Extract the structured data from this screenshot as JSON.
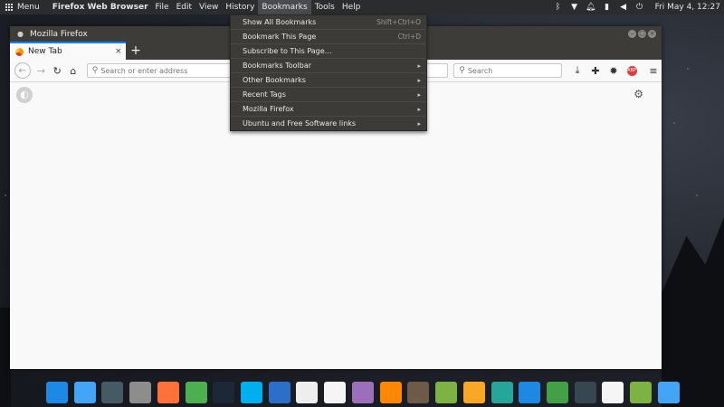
{
  "top_panel": {
    "menu_label": "Menu",
    "app_name": "Firefox Web Browser",
    "menus": [
      "File",
      "Edit",
      "View",
      "History",
      "Bookmarks",
      "Tools",
      "Help"
    ],
    "active_menu": "Bookmarks",
    "clock": "Fri May 4, 12:27"
  },
  "window": {
    "title": "Mozilla Firefox",
    "tab": {
      "title": "New Tab",
      "close": "×"
    },
    "new_tab": "+",
    "url_placeholder": "Search or enter address",
    "search_placeholder": "Search"
  },
  "bookmarks_menu": {
    "items": [
      {
        "label": "Show All Bookmarks",
        "shortcut": "Shift+Ctrl+O",
        "submenu": ""
      },
      {
        "label": "Bookmark This Page",
        "shortcut": "Ctrl+D",
        "submenu": ""
      },
      {
        "label": "Subscribe to This Page…",
        "shortcut": "",
        "submenu": ""
      },
      {
        "label": "Bookmarks Toolbar",
        "shortcut": "",
        "submenu": "▸"
      },
      {
        "label": "Other Bookmarks",
        "shortcut": "",
        "submenu": "▸"
      },
      {
        "label": "Recent Tags",
        "shortcut": "",
        "submenu": "▸"
      },
      {
        "label": "Mozilla Firefox",
        "shortcut": "",
        "submenu": "▸"
      },
      {
        "label": "Ubuntu and Free Software links",
        "shortcut": "",
        "submenu": "▸"
      }
    ]
  },
  "dock": [
    {
      "name": "anchor-icon",
      "color": "#1e88e5"
    },
    {
      "name": "desktop-icon",
      "color": "#42a5f5"
    },
    {
      "name": "screenshot-icon",
      "color": "#455a64"
    },
    {
      "name": "files-icon",
      "color": "#8d8d8d"
    },
    {
      "name": "firefox-icon",
      "color": "#ff7139"
    },
    {
      "name": "chrome-icon",
      "color": "#4caf50"
    },
    {
      "name": "steam-icon",
      "color": "#1b2838"
    },
    {
      "name": "skype-icon",
      "color": "#00aff0"
    },
    {
      "name": "thunderbird-icon",
      "color": "#2a6fc9"
    },
    {
      "name": "document-icon",
      "color": "#eeeeee"
    },
    {
      "name": "text-editor-icon",
      "color": "#f5f5f5"
    },
    {
      "name": "archive-icon",
      "color": "#9c6fbd"
    },
    {
      "name": "vlc-icon",
      "color": "#ff8800"
    },
    {
      "name": "gimp-icon",
      "color": "#6d5a47"
    },
    {
      "name": "hanger-icon",
      "color": "#7cb342"
    },
    {
      "name": "link-icon",
      "color": "#f9a825"
    },
    {
      "name": "settings-icon",
      "color": "#26a69a"
    },
    {
      "name": "workspace-icon",
      "color": "#1e88e5"
    },
    {
      "name": "monitor-icon",
      "color": "#43a047"
    },
    {
      "name": "terminal-icon",
      "color": "#37474f"
    },
    {
      "name": "clock-icon",
      "color": "#f5f5f5"
    },
    {
      "name": "trash-icon",
      "color": "#7cb342"
    },
    {
      "name": "window-icon",
      "color": "#42a5f5"
    }
  ]
}
